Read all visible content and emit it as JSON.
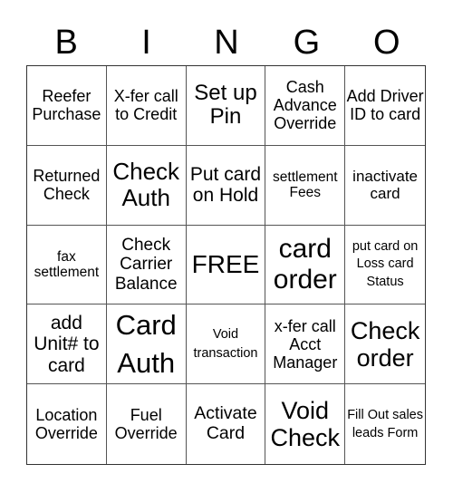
{
  "header": {
    "letters": [
      "B",
      "I",
      "N",
      "G",
      "O"
    ]
  },
  "cells": [
    [
      "Reefer Purchase",
      "X-fer call to Credit",
      "Set up Pin",
      "Cash Advance Override",
      "Add Driver ID to card"
    ],
    [
      "Returned Check",
      "Check Auth",
      "Put card on Hold",
      "settlement Fees",
      "inactivate card"
    ],
    [
      "fax settlement",
      "Check Carrier Balance",
      "FREE",
      "card order",
      "put card on Loss card Status"
    ],
    [
      "add Unit# to card",
      "Card Auth",
      "Void transaction",
      "x-fer call Acct Manager",
      "Check order"
    ],
    [
      "Location Override",
      "Fuel Override",
      "Activate Card",
      "Void Check",
      "Fill Out sales leads Form"
    ]
  ]
}
